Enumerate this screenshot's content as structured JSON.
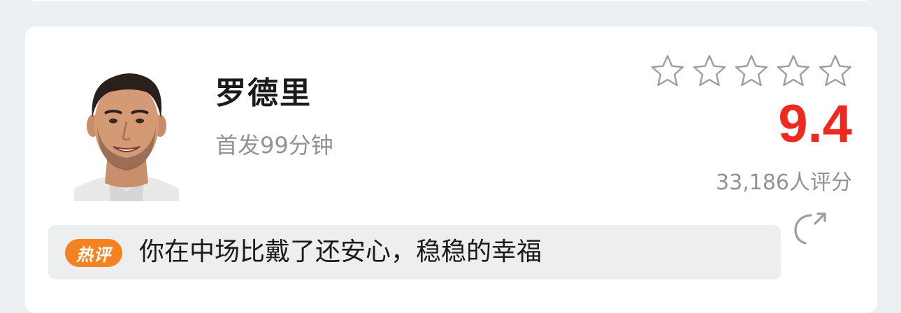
{
  "player": {
    "name": "罗德里",
    "subtitle": "首发99分钟"
  },
  "rating": {
    "stars_total": 5,
    "stars_filled": 0,
    "score": "9.4",
    "count_label": "33,186人评分",
    "score_color": "#ee2a1f"
  },
  "hot_comment": {
    "badge": "热评",
    "badge_color": "#f58220",
    "text": "你在中场比戴了还安心，稳稳的幸福"
  },
  "icons": {
    "star": "star-outline-icon",
    "share": "share-arrow-icon",
    "avatar": "player-avatar"
  }
}
